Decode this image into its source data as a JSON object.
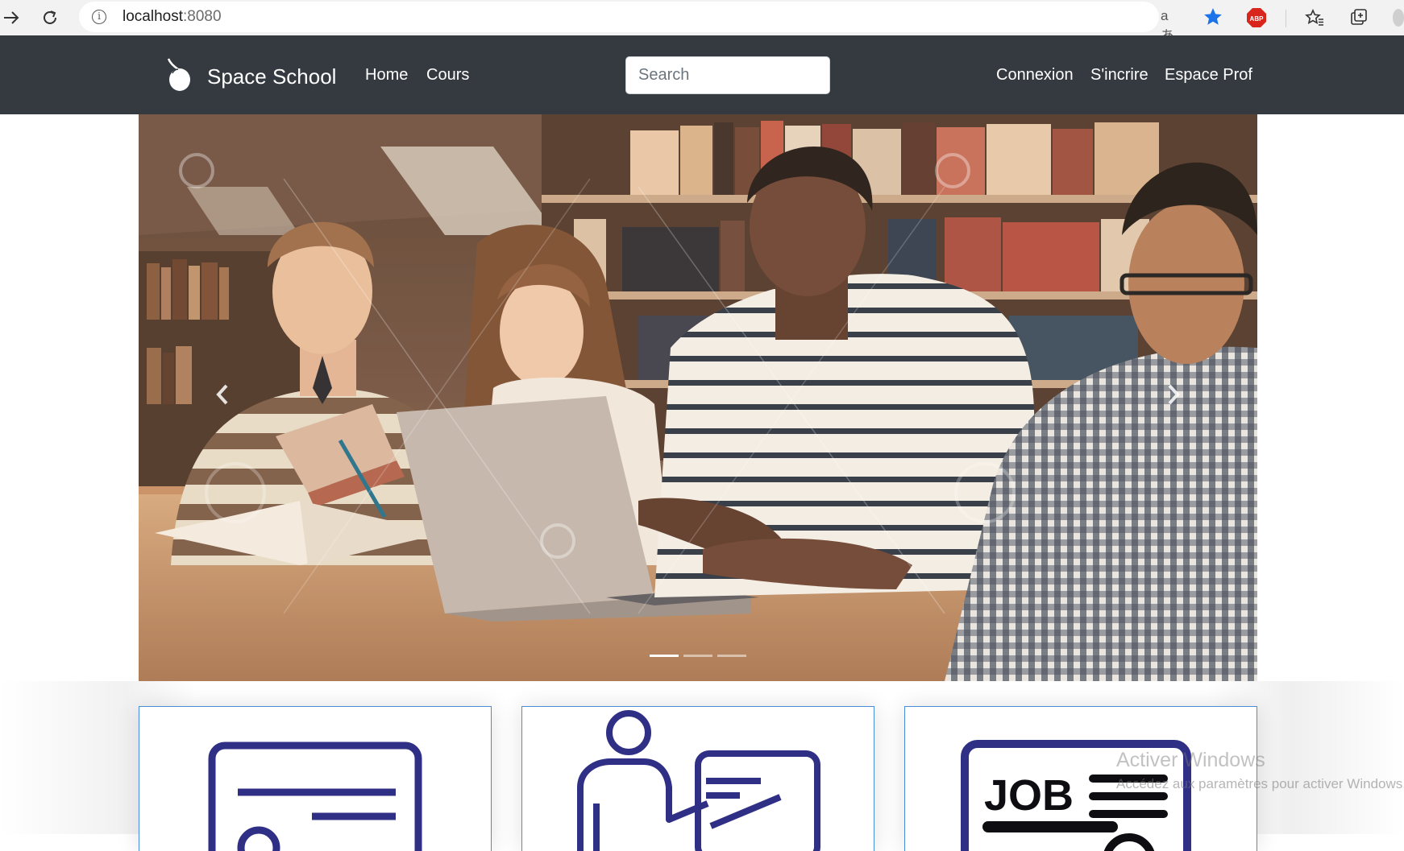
{
  "browser": {
    "url_host": "localhost",
    "url_port": ":8080",
    "translate_label": "aあ",
    "extension_badge": "ABP"
  },
  "navbar": {
    "brand": "Space School",
    "links": [
      "Home",
      "Cours"
    ],
    "search_placeholder": "Search",
    "right_links": [
      "Connexion",
      "S'incrire",
      "Espace Prof"
    ]
  },
  "carousel": {
    "slide_count": 3,
    "active_slide": 1
  },
  "cards": [
    {
      "icon": "certificate-icon"
    },
    {
      "icon": "teacher-board-icon"
    },
    {
      "icon": "job-icon",
      "icon_text": "JOB"
    }
  ],
  "watermark": {
    "line1": "Activer Windows",
    "line2": "Accédez aux paramètres pour activer Windows."
  },
  "colors": {
    "navbar_bg": "#343a40",
    "card_border": "#4a8cd8",
    "icon_stroke": "#2f2f86",
    "bookmark_star": "#1a73e8",
    "abp_red": "#d9261c"
  }
}
